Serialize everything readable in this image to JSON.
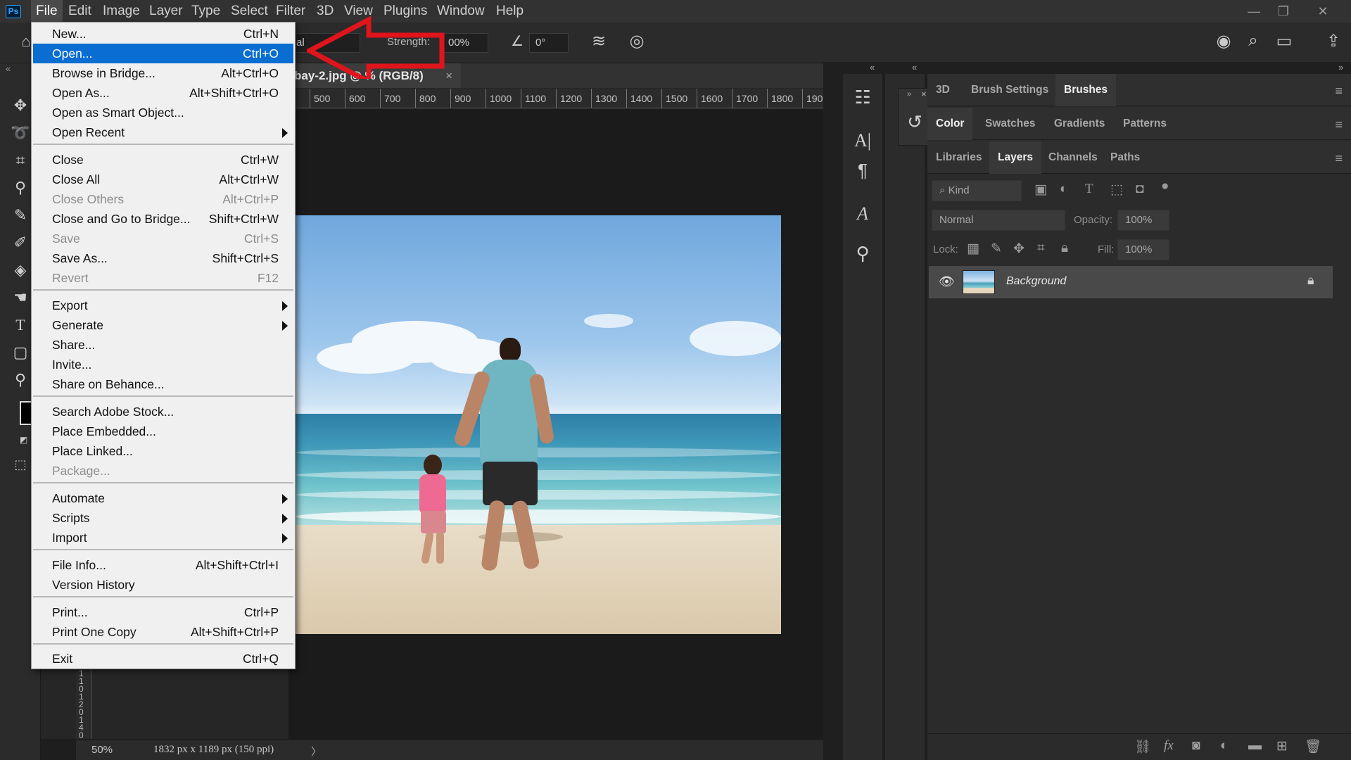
{
  "app": {
    "logo": "Ps",
    "menu": [
      "File",
      "Edit",
      "Image",
      "Layer",
      "Type",
      "Select",
      "Filter",
      "3D",
      "View",
      "Plugins",
      "Window",
      "Help"
    ],
    "active_menu": "File",
    "window_controls": {
      "minimize": "—",
      "restore": "❐",
      "close": "✕"
    }
  },
  "options_bar": {
    "mode_partial": "al",
    "strength_label": "Strength:",
    "strength_value": "00%",
    "angle_value": "0°"
  },
  "document": {
    "tab_title": "bay-2.jpg @ ",
    "tab_title_tail": "% (RGB/8)",
    "zoom": "50%",
    "doc_info": "1832 px x 1189 px (150 ppi)",
    "status_arrow": "〉",
    "ruler_labels": [
      "500",
      "600",
      "700",
      "800",
      "900",
      "1000",
      "1100",
      "1200",
      "1300",
      "1400",
      "1500",
      "1600",
      "1700",
      "1800",
      "190"
    ],
    "left_ruler_digits": [
      "1",
      "1",
      "0",
      "1",
      "2",
      "0",
      "1",
      "4",
      "0"
    ]
  },
  "file_menu": {
    "groups": [
      [
        {
          "label": "New...",
          "shortcut": "Ctrl+N"
        },
        {
          "label": "Open...",
          "shortcut": "Ctrl+O",
          "selected": true
        },
        {
          "label": "Browse in Bridge...",
          "shortcut": "Alt+Ctrl+O"
        },
        {
          "label": "Open As...",
          "shortcut": "Alt+Shift+Ctrl+O"
        },
        {
          "label": "Open as Smart Object...",
          "shortcut": ""
        },
        {
          "label": "Open Recent",
          "shortcut": "",
          "submenu": true
        }
      ],
      [
        {
          "label": "Close",
          "shortcut": "Ctrl+W"
        },
        {
          "label": "Close All",
          "shortcut": "Alt+Ctrl+W"
        },
        {
          "label": "Close Others",
          "shortcut": "Alt+Ctrl+P",
          "disabled": true
        },
        {
          "label": "Close and Go to Bridge...",
          "shortcut": "Shift+Ctrl+W"
        },
        {
          "label": "Save",
          "shortcut": "Ctrl+S",
          "disabled": true
        },
        {
          "label": "Save As...",
          "shortcut": "Shift+Ctrl+S"
        },
        {
          "label": "Revert",
          "shortcut": "F12",
          "disabled": true
        }
      ],
      [
        {
          "label": "Export",
          "shortcut": "",
          "submenu": true
        },
        {
          "label": "Generate",
          "shortcut": "",
          "submenu": true
        },
        {
          "label": "Share...",
          "shortcut": ""
        },
        {
          "label": "Invite...",
          "shortcut": ""
        },
        {
          "label": "Share on Behance...",
          "shortcut": ""
        }
      ],
      [
        {
          "label": "Search Adobe Stock...",
          "shortcut": ""
        },
        {
          "label": "Place Embedded...",
          "shortcut": ""
        },
        {
          "label": "Place Linked...",
          "shortcut": ""
        },
        {
          "label": "Package...",
          "shortcut": "",
          "disabled": true
        }
      ],
      [
        {
          "label": "Automate",
          "shortcut": "",
          "submenu": true
        },
        {
          "label": "Scripts",
          "shortcut": "",
          "submenu": true
        },
        {
          "label": "Import",
          "shortcut": "",
          "submenu": true
        }
      ],
      [
        {
          "label": "File Info...",
          "shortcut": "Alt+Shift+Ctrl+I"
        },
        {
          "label": "Version History",
          "shortcut": ""
        }
      ],
      [
        {
          "label": "Print...",
          "shortcut": "Ctrl+P"
        },
        {
          "label": "Print One Copy",
          "shortcut": "Alt+Shift+Ctrl+P"
        }
      ],
      [
        {
          "label": "Exit",
          "shortcut": "Ctrl+Q"
        }
      ]
    ]
  },
  "panels": {
    "row1_tabs": [
      "3D",
      "Brush Settings",
      "Brushes"
    ],
    "row1_active": "Brushes",
    "row2_tabs": [
      "Color",
      "Swatches",
      "Gradients",
      "Patterns"
    ],
    "row2_active": "Color",
    "row3_tabs": [
      "Libraries",
      "Layers",
      "Channels",
      "Paths"
    ],
    "row3_active": "Layers",
    "layers": {
      "filter_placeholder": "Kind",
      "blend_mode": "Normal",
      "opacity_label": "Opacity:",
      "opacity_value": "100%",
      "lock_label": "Lock:",
      "fill_label": "Fill:",
      "fill_value": "100%",
      "items": [
        {
          "name": "Background",
          "visible": true,
          "locked": true
        }
      ]
    }
  },
  "colors": {
    "accent": "#0a6dd1",
    "annotation_arrow": "#e0141b"
  }
}
